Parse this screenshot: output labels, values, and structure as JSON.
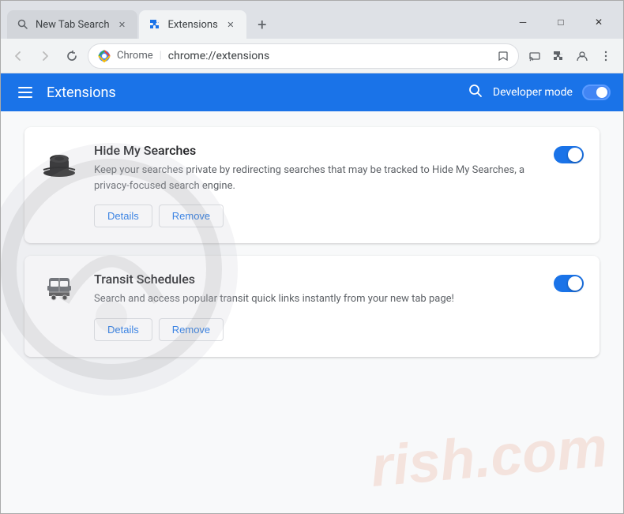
{
  "browser": {
    "tabs": [
      {
        "id": "tab-new-tab-search",
        "label": "New Tab Search",
        "icon": "search-icon",
        "active": false
      },
      {
        "id": "tab-extensions",
        "label": "Extensions",
        "icon": "puzzle-icon",
        "active": true
      }
    ],
    "new_tab_label": "+",
    "window_controls": {
      "minimize": "─",
      "maximize": "□",
      "close": "✕"
    },
    "address_bar": {
      "protocol": "Chrome",
      "url": "chrome://extensions",
      "separator": "|"
    },
    "nav": {
      "back_disabled": true,
      "forward_disabled": true
    }
  },
  "extensions_page": {
    "header": {
      "menu_label": "menu",
      "title": "Extensions",
      "search_label": "search",
      "developer_mode_label": "Developer mode",
      "toggle_enabled": true
    },
    "extensions": [
      {
        "id": "hide-my-searches",
        "name": "Hide My Searches",
        "description": "Keep your searches private by redirecting searches that may be tracked to Hide My Searches, a privacy-focused search engine.",
        "icon_type": "hat",
        "details_label": "Details",
        "remove_label": "Remove",
        "enabled": true
      },
      {
        "id": "transit-schedules",
        "name": "Transit Schedules",
        "description": "Search and access popular transit quick links instantly from your new tab page!",
        "icon_type": "bus",
        "details_label": "Details",
        "remove_label": "Remove",
        "enabled": true
      }
    ]
  },
  "watermark": {
    "text": "rish.com"
  },
  "colors": {
    "chrome_blue": "#1a73e8",
    "header_bg": "#dee1e6",
    "tab_active_bg": "#f1f3f4",
    "tab_inactive_bg": "#d2d5da"
  }
}
